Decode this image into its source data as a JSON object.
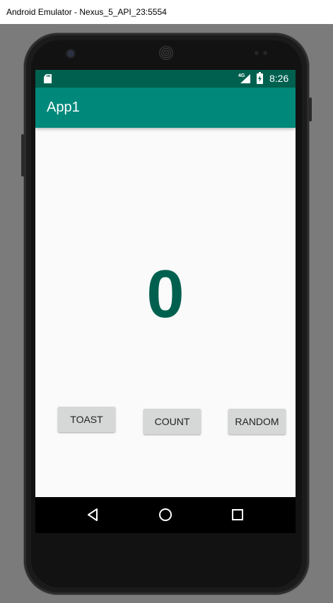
{
  "window": {
    "title": "Android Emulator - Nexus_5_API_23:5554"
  },
  "status_bar": {
    "icons": [
      "sd-card-icon",
      "signal-icon",
      "battery-charging-icon"
    ],
    "network": "4G",
    "time": "8:26"
  },
  "toolbar": {
    "title": "App1"
  },
  "main": {
    "count": "0"
  },
  "buttons": {
    "toast": "TOAST",
    "count": "COUNT",
    "random": "RANDOM"
  },
  "nav_bar": {
    "icons": [
      "back-icon",
      "home-icon",
      "recents-icon"
    ]
  },
  "colors": {
    "primary": "#00897b",
    "primary_dark": "#00604f",
    "counter_text": "#00604f",
    "button_bg": "#d6d7d7"
  }
}
